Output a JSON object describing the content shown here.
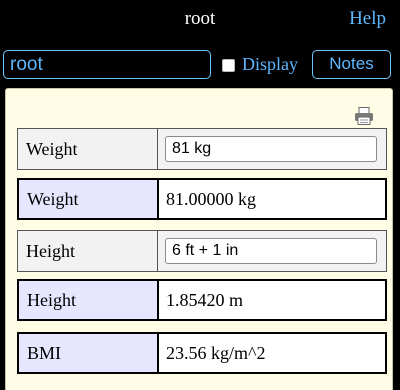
{
  "window": {
    "title": "root",
    "help_label": "Help"
  },
  "toolbar": {
    "name_value": "root",
    "display_label": "Display",
    "display_checked": false,
    "notes_label": "Notes"
  },
  "calculator": {
    "rows": [
      {
        "label": "Weight",
        "kind": "input",
        "value": "81 kg"
      },
      {
        "label": "Weight",
        "kind": "output",
        "value": "81.00000 kg"
      },
      {
        "label": "Height",
        "kind": "input",
        "value": "6 ft + 1 in"
      },
      {
        "label": "Height",
        "kind": "output",
        "value": "1.85420 m"
      },
      {
        "label": "BMI",
        "kind": "output",
        "value": "23.56 kg/m^2"
      }
    ]
  },
  "icons": {
    "print": "printer-icon"
  }
}
